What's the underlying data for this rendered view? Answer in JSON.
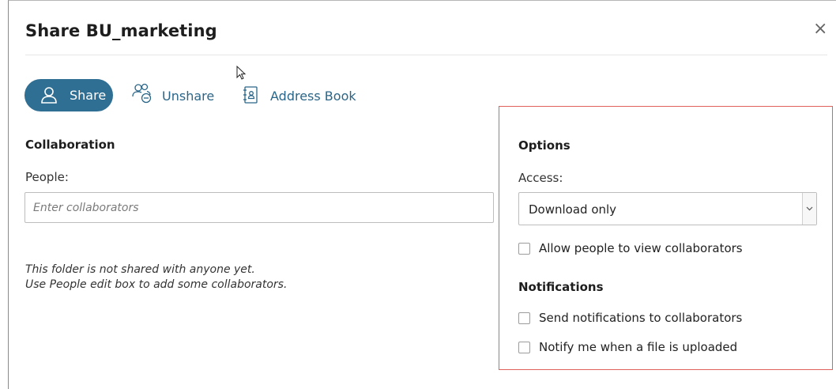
{
  "dialog": {
    "title": "Share BU_marketing",
    "close_label": "×"
  },
  "toolbar": {
    "share_label": "Share",
    "unshare_label": "Unshare",
    "address_book_label": "Address Book"
  },
  "collaboration": {
    "heading": "Collaboration",
    "people_label": "People:",
    "people_placeholder": "Enter collaborators",
    "people_value": "",
    "empty_line1": "This folder is not shared with anyone yet.",
    "empty_line2": "Use People edit box to add some collaborators."
  },
  "options": {
    "heading": "Options",
    "access_label": "Access:",
    "access_value": "Download only",
    "allow_view_label": "Allow people to view collaborators",
    "allow_view_checked": false
  },
  "notifications": {
    "heading": "Notifications",
    "send_label": "Send notifications to collaborators",
    "send_checked": false,
    "notify_upload_label": "Notify me when a file is uploaded",
    "notify_upload_checked": false
  },
  "colors": {
    "accent": "#2f6f93",
    "link": "#2a6689",
    "highlight_border": "#e0605c"
  },
  "icons": [
    "user-icon",
    "users-minus-icon",
    "address-book-icon",
    "close-icon",
    "chevron-down-icon",
    "mouse-cursor-icon"
  ]
}
